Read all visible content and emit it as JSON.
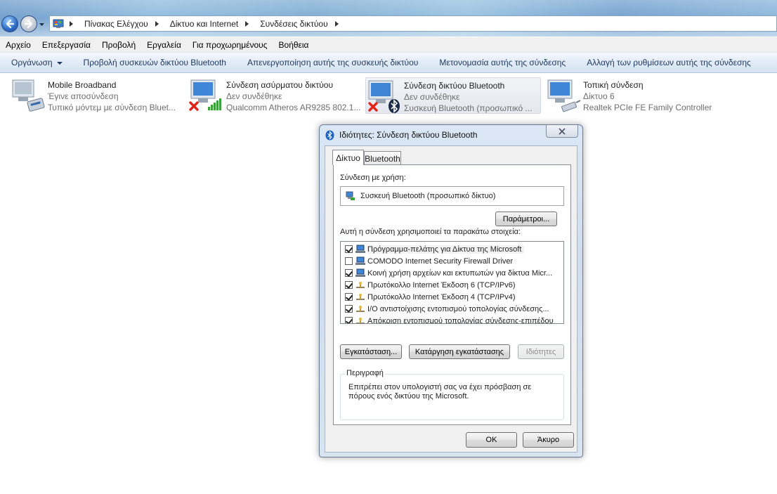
{
  "breadcrumb": [
    "Πίνακας Ελέγχου",
    "Δίκτυο και Internet",
    "Συνδέσεις δικτύου"
  ],
  "menu": [
    "Αρχείο",
    "Επεξεργασία",
    "Προβολή",
    "Εργαλεία",
    "Για προχωρημένους",
    "Βοήθεια"
  ],
  "commands": {
    "organize": "Οργάνωση",
    "view_bt": "Προβολή συσκευών δικτύου Bluetooth",
    "disable": "Απενεργοποίηση αυτής της συσκευής δικτύου",
    "rename": "Μετονομασία αυτής της σύνδεσης",
    "change": "Αλλαγή των ρυθμίσεων αυτής της σύνδεσης"
  },
  "connections": [
    {
      "name": "Mobile Broadband",
      "status": "Έγινε αποσύνδεση",
      "device": "Τυπικό μόντεμ με σύνδεση Bluet..."
    },
    {
      "name": "Σύνδεση ασύρματου δικτύου",
      "status": "Δεν συνδέθηκε",
      "device": "Qualcomm Atheros AR9285 802.1..."
    },
    {
      "name": "Σύνδεση δικτύου Bluetooth",
      "status": "Δεν συνδέθηκε",
      "device": "Συσκευή Bluetooth (προσωπικό ..."
    },
    {
      "name": "Τοπική σύνδεση",
      "status": "Δίκτυο  6",
      "device": "Realtek PCIe FE Family Controller"
    }
  ],
  "dialog": {
    "title": "Ιδιότητες: Σύνδεση δικτύου Bluetooth",
    "tabs": [
      "Δίκτυο",
      "Bluetooth"
    ],
    "connect_using_label": "Σύνδεση με χρήση:",
    "device": "Συσκευή Bluetooth (προσωπικό δίκτυο)",
    "configure": "Παράμετροι...",
    "items_label": "Αυτή η σύνδεση χρησιμοποιεί τα παρακάτω στοιχεία:",
    "items": [
      {
        "label": "Πρόγραμμα-πελάτης για Δίκτυα της Microsoft",
        "checked": true,
        "icon": "network-client-icon"
      },
      {
        "label": "COMODO Internet Security Firewall Driver",
        "checked": false,
        "icon": "network-client-icon"
      },
      {
        "label": "Κοινή χρήση αρχείων και εκτυπωτών για δίκτυα Micr...",
        "checked": true,
        "icon": "network-client-icon"
      },
      {
        "label": "Πρωτόκολλο Internet Έκδοση 6 (TCP/IPv6)",
        "checked": true,
        "icon": "protocol-icon"
      },
      {
        "label": "Πρωτόκολλο Internet Έκδοση 4 (TCP/IPv4)",
        "checked": true,
        "icon": "protocol-icon"
      },
      {
        "label": "I/O αντιστοίχισης εντοπισμού τοπολογίας σύνδεσης...",
        "checked": true,
        "icon": "protocol-icon"
      },
      {
        "label": "Απόκριση εντοπισμού τοπολογίας σύνδεσης-επιπέδου",
        "checked": true,
        "icon": "protocol-icon"
      }
    ],
    "install": "Εγκατάσταση...",
    "uninstall": "Κατάργηση εγκατάστασης",
    "properties": "Ιδιότητες",
    "description_label": "Περιγραφή",
    "description": "Επιτρέπει στον υπολογιστή σας να έχει πρόσβαση σε πόρους ενός δικτύου της Microsoft.",
    "ok": "OK",
    "cancel": "Άκυρο"
  }
}
